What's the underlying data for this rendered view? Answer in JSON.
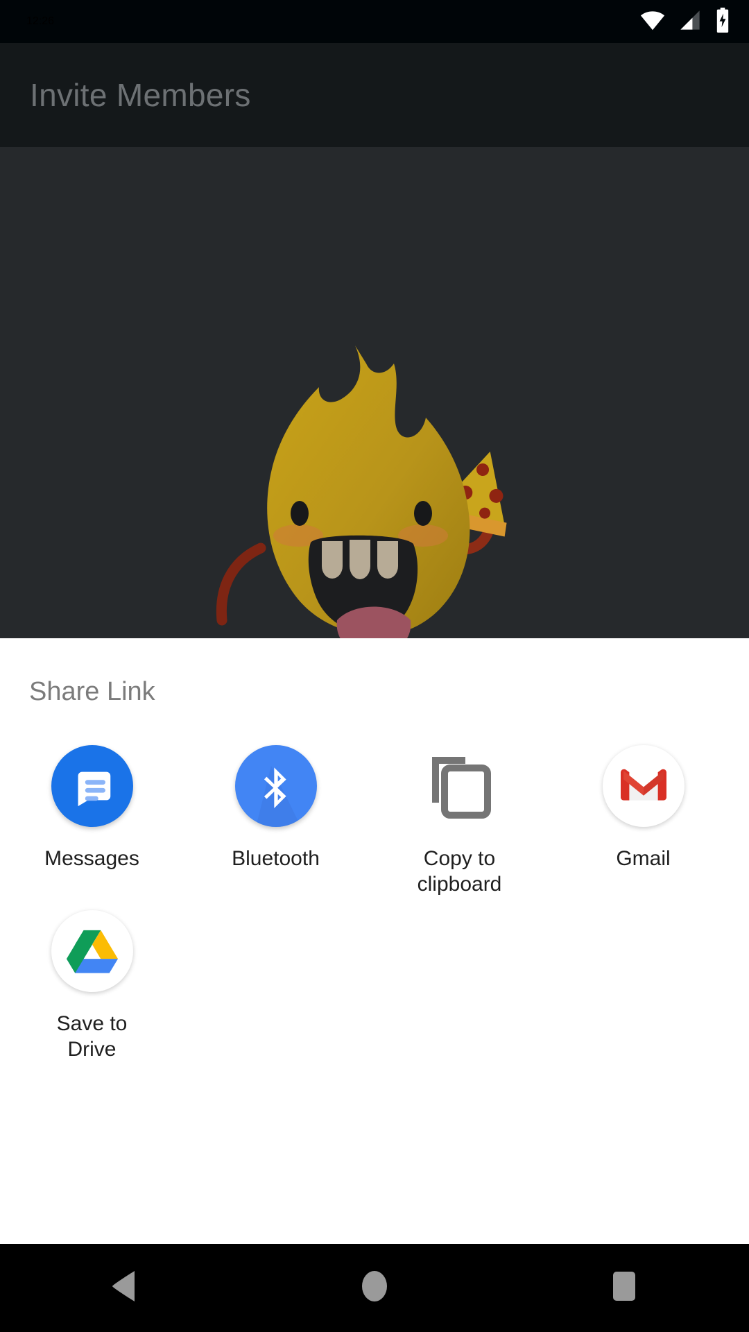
{
  "status_bar": {
    "time": "12:26",
    "icons": [
      "wifi-icon",
      "cellular-signal-icon",
      "battery-charging-icon"
    ]
  },
  "app_header": {
    "title": "Invite Members"
  },
  "content": {
    "illustration_name": "flame-monster-with-pizza-illustration",
    "background_color": "#26292c"
  },
  "share_sheet": {
    "title": "Share Link",
    "background_color": "#ffffff",
    "targets": [
      {
        "label": "Messages",
        "icon": "messages-icon",
        "color": "#1a73e8"
      },
      {
        "label": "Bluetooth",
        "icon": "bluetooth-icon",
        "color": "#4285f4"
      },
      {
        "label": "Copy to clipboard",
        "icon": "copy-to-clipboard-icon",
        "color": "#757575"
      },
      {
        "label": "Gmail",
        "icon": "gmail-icon",
        "color": "#d93025"
      },
      {
        "label": "Save to Drive",
        "icon": "google-drive-icon",
        "color": "#fbbc04"
      }
    ]
  },
  "nav_bar": {
    "buttons": [
      {
        "name": "back-button",
        "icon": "triangle-back-icon"
      },
      {
        "name": "home-button",
        "icon": "circle-home-icon"
      },
      {
        "name": "recents-button",
        "icon": "square-recents-icon"
      }
    ],
    "icon_color": "#9a9a9a"
  }
}
